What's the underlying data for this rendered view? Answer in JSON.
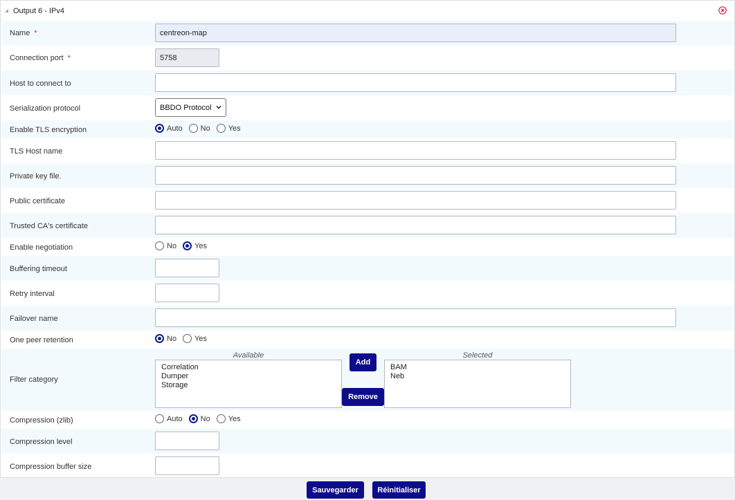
{
  "panel": {
    "title": "Output 6 - IPv4"
  },
  "fields": {
    "name": {
      "label": "Name",
      "value": "centreon-map",
      "required_mark": "*"
    },
    "connection_port": {
      "label": "Connection port",
      "value": "5758",
      "required_mark": "*"
    },
    "host": {
      "label": "Host to connect to",
      "value": ""
    },
    "serialization": {
      "label": "Serialization protocol",
      "selected": "BBDO Protocol"
    },
    "tls": {
      "label": "Enable TLS encryption",
      "options": [
        "Auto",
        "No",
        "Yes"
      ],
      "selected": "Auto"
    },
    "tls_host": {
      "label": "TLS Host name",
      "value": ""
    },
    "private_key": {
      "label": "Private key file.",
      "value": ""
    },
    "public_cert": {
      "label": "Public certificate",
      "value": ""
    },
    "trusted_ca": {
      "label": "Trusted CA's certificate",
      "value": ""
    },
    "negotiation": {
      "label": "Enable negotiation",
      "options": [
        "No",
        "Yes"
      ],
      "selected": "Yes"
    },
    "buffering_timeout": {
      "label": "Buffering timeout",
      "value": ""
    },
    "retry_interval": {
      "label": "Retry interval",
      "value": ""
    },
    "failover": {
      "label": "Failover name",
      "value": ""
    },
    "peer_retention": {
      "label": "One peer retention",
      "options": [
        "No",
        "Yes"
      ],
      "selected": "No"
    },
    "filter_category": {
      "label": "Filter category",
      "available_header": "Available",
      "selected_header": "Selected",
      "available": [
        "Correlation",
        "Dumper",
        "Storage"
      ],
      "selected": [
        "BAM",
        "Neb"
      ],
      "add_label": "Add",
      "remove_label": "Remove"
    },
    "compression": {
      "label": "Compression (zlib)",
      "options": [
        "Auto",
        "No",
        "Yes"
      ],
      "selected": "No"
    },
    "compression_level": {
      "label": "Compression level",
      "value": ""
    },
    "compression_buffer": {
      "label": "Compression buffer size",
      "value": ""
    }
  },
  "actions": {
    "save_label": "Sauvegarder",
    "reset_label": "Réinitialiser"
  },
  "colors": {
    "accent": "#0d0d8c",
    "close_icon": "#e11d48",
    "row_alt": "#f3fafe",
    "required": "#e11d48"
  },
  "icons": {
    "collapse": "collapse-triangle-icon",
    "close": "close-circle-icon",
    "dropdown": "chevron-down-icon"
  }
}
